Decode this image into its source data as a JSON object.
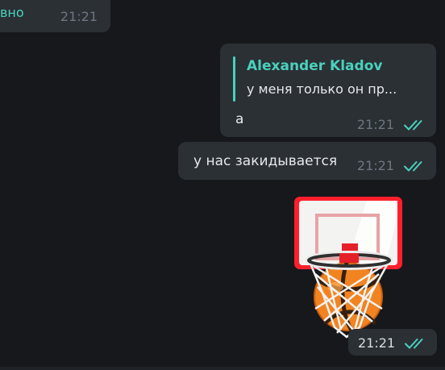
{
  "messages": {
    "incoming": {
      "text": "вно",
      "time": "21:21"
    },
    "reply": {
      "quote_author": "Alexander Kladov",
      "quote_text": "у меня только он пр...",
      "text": "а",
      "time": "21:21",
      "status": "read"
    },
    "plain": {
      "text": "у нас закидывается",
      "time": "21:21",
      "status": "read"
    },
    "sticker": {
      "emoji": "basketball",
      "time": "21:21",
      "status": "read"
    }
  },
  "colors": {
    "background": "#17181c",
    "bubble": "#2b3035",
    "accent": "#49d1bd",
    "text": "#e6e8ea",
    "muted": "#6d7680"
  }
}
